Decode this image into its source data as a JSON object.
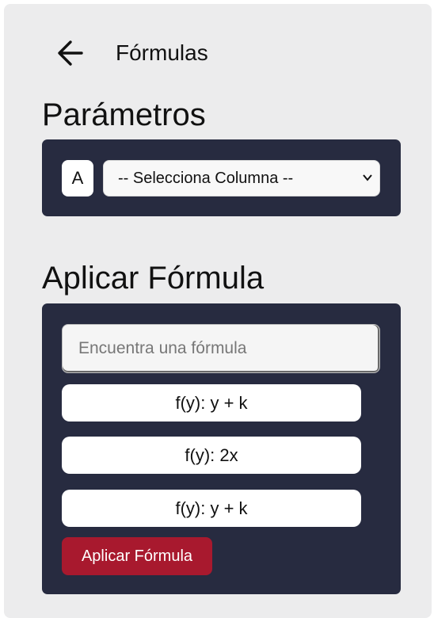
{
  "header": {
    "title": "Fórmulas",
    "back_icon": "arrow-left-icon"
  },
  "parameters": {
    "title": "Parámetros",
    "letter": "A",
    "column_select": {
      "selected": "-- Selecciona Columna --",
      "icon": "chevron-down-icon"
    }
  },
  "apply": {
    "title": "Aplicar Fórmula",
    "search_placeholder": "Encuentra una fórmula",
    "formulas": [
      "f(y): y + k",
      "f(y): 2x",
      "f(y): y + k"
    ],
    "button_label": "Aplicar Fórmula"
  },
  "colors": {
    "panel_bg": "#ececed",
    "box_bg": "#272b40",
    "button_accent": "#a8192e"
  }
}
